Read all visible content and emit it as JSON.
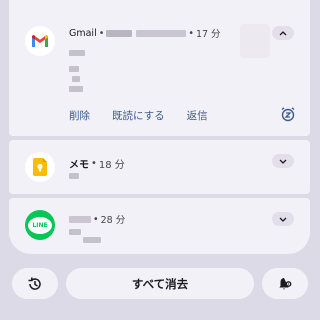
{
  "notifications": [
    {
      "app": "Gmail",
      "time": "17 分",
      "actions": [
        "削除",
        "既読にする",
        "返信"
      ],
      "icon": "gmail-icon"
    },
    {
      "app": "メモ",
      "time": "18 分",
      "icon": "keep-memo-icon"
    },
    {
      "app": "",
      "time": "28 分",
      "icon": "line-icon",
      "icon_text": "LINE"
    }
  ],
  "footer": {
    "clear_all_label": "すべて消去"
  },
  "colors": {
    "background": "#dcdae6",
    "card": "#f3f1f8",
    "action_text": "#3b5a8f",
    "line_green": "#06c755",
    "keep_yellow": "#fbbc04"
  }
}
